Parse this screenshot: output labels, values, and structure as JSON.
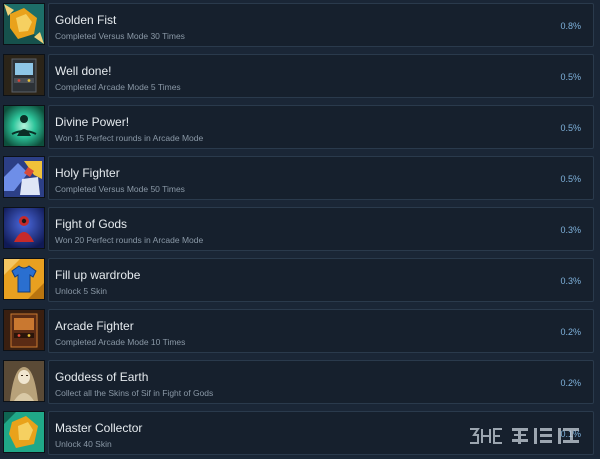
{
  "achievements": [
    {
      "title": "Golden Fist",
      "description": "Completed Versus Mode 30 Times",
      "percent": "0.8%",
      "icon": "golden-fist-icon",
      "icon_colors": [
        "#e9a21b",
        "#1fa39a"
      ]
    },
    {
      "title": "Well done!",
      "description": "Completed Arcade Mode 5 Times",
      "percent": "0.5%",
      "icon": "arcade-cabinet-icon",
      "icon_colors": [
        "#3a3f44",
        "#8ec6e6"
      ]
    },
    {
      "title": "Divine Power!",
      "description": "Won 15 Perfect rounds in Arcade Mode",
      "percent": "0.5%",
      "icon": "divine-power-icon",
      "icon_colors": [
        "#2dc49a",
        "#0e4f3c"
      ]
    },
    {
      "title": "Holy Fighter",
      "description": "Completed Versus Mode 50 Times",
      "percent": "0.5%",
      "icon": "holy-fighter-icon",
      "icon_colors": [
        "#6e8ee8",
        "#f0c23a"
      ]
    },
    {
      "title": "Fight of Gods",
      "description": "Won 20 Perfect rounds in Arcade Mode",
      "percent": "0.3%",
      "icon": "fight-of-gods-icon",
      "icon_colors": [
        "#1b2a8a",
        "#c62a2a"
      ]
    },
    {
      "title": "Fill up wardrobe",
      "description": "Unlock 5 Skin",
      "percent": "0.3%",
      "icon": "shirt-icon",
      "icon_colors": [
        "#e8a020",
        "#2a6fd0"
      ]
    },
    {
      "title": "Arcade Fighter",
      "description": "Completed Arcade Mode 10 Times",
      "percent": "0.2%",
      "icon": "arcade-fighter-icon",
      "icon_colors": [
        "#5a2b14",
        "#c97830"
      ]
    },
    {
      "title": "Goddess of Earth",
      "description": "Collect all the Skins of Sif in Fight of Gods",
      "percent": "0.2%",
      "icon": "goddess-icon",
      "icon_colors": [
        "#b8a27a",
        "#f0e6d0"
      ]
    },
    {
      "title": "Master Collector",
      "description": "Unlock 40 Skin",
      "percent": "0.1%",
      "icon": "master-collector-icon",
      "icon_colors": [
        "#e9a21b",
        "#20a888"
      ]
    }
  ],
  "watermark": {
    "text": "3DMGAME 当游网",
    "icon": "watermark-logo"
  }
}
